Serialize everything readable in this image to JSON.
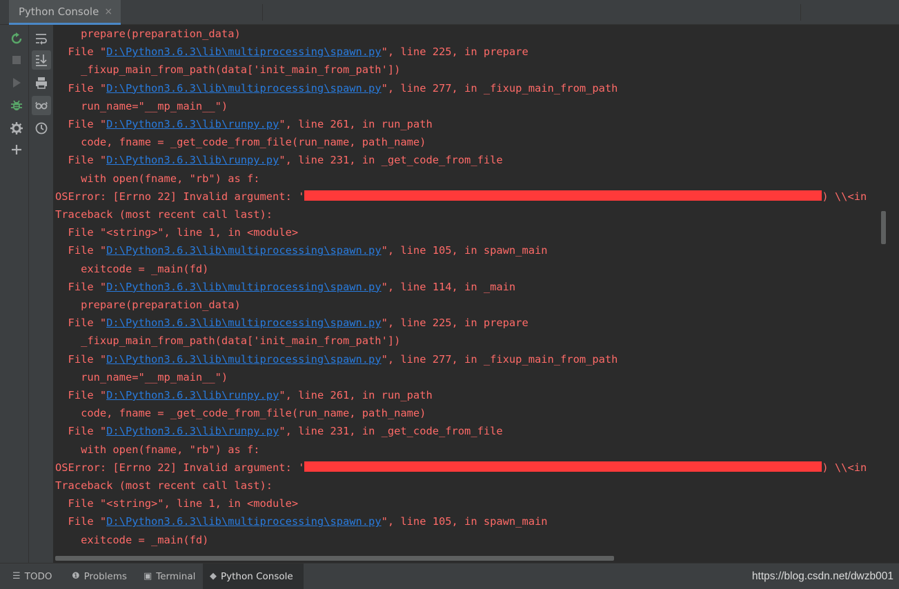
{
  "window": {
    "tab_title": "Python Console",
    "tab_close": "×"
  },
  "toolbar_left": [
    "rerun-icon",
    "stop-icon",
    "run-icon",
    "debug-icon",
    "settings-icon",
    "add-icon"
  ],
  "toolbar_right": [
    "soft-wrap-icon",
    "scroll-to-end-icon",
    "print-icon",
    "show-variables-icon",
    "history-icon"
  ],
  "console": {
    "lines": [
      {
        "indent": "    ",
        "parts": [
          {
            "t": "prepare(preparation_data)"
          }
        ]
      },
      {
        "indent": "  ",
        "parts": [
          {
            "t": "File \""
          },
          {
            "t": "D:\\Python3.6.3\\lib\\multiprocessing\\spawn.py",
            "link": true
          },
          {
            "t": "\", line 225, in prepare"
          }
        ]
      },
      {
        "indent": "    ",
        "parts": [
          {
            "t": "_fixup_main_from_path(data['init_main_from_path'])"
          }
        ]
      },
      {
        "indent": "  ",
        "parts": [
          {
            "t": "File \""
          },
          {
            "t": "D:\\Python3.6.3\\lib\\multiprocessing\\spawn.py",
            "link": true
          },
          {
            "t": "\", line 277, in _fixup_main_from_path"
          }
        ]
      },
      {
        "indent": "    ",
        "parts": [
          {
            "t": "run_name=\"__mp_main__\")"
          }
        ]
      },
      {
        "indent": "  ",
        "parts": [
          {
            "t": "File \""
          },
          {
            "t": "D:\\Python3.6.3\\lib\\runpy.py",
            "link": true
          },
          {
            "t": "\", line 261, in run_path"
          }
        ]
      },
      {
        "indent": "    ",
        "parts": [
          {
            "t": "code, fname = _get_code_from_file(run_name, path_name)"
          }
        ]
      },
      {
        "indent": "  ",
        "parts": [
          {
            "t": "File \""
          },
          {
            "t": "D:\\Python3.6.3\\lib\\runpy.py",
            "link": true
          },
          {
            "t": "\", line 231, in _get_code_from_file"
          }
        ]
      },
      {
        "indent": "    ",
        "parts": [
          {
            "t": "with open(fname, \"rb\") as f:"
          }
        ]
      },
      {
        "indent": "",
        "parts": [
          {
            "t": "OSError: [Errno 22] Invalid argument: '"
          },
          {
            "redact": 75
          },
          {
            "t": ") \\\\<in"
          }
        ]
      },
      {
        "indent": "",
        "parts": [
          {
            "t": "Traceback (most recent call last):"
          }
        ]
      },
      {
        "indent": "  ",
        "parts": [
          {
            "t": "File \"<string>\", line 1, in <module>"
          }
        ]
      },
      {
        "indent": "  ",
        "parts": [
          {
            "t": "File \""
          },
          {
            "t": "D:\\Python3.6.3\\lib\\multiprocessing\\spawn.py",
            "link": true
          },
          {
            "t": "\", line 105, in spawn_main"
          }
        ]
      },
      {
        "indent": "    ",
        "parts": [
          {
            "t": "exitcode = _main(fd)"
          }
        ]
      },
      {
        "indent": "  ",
        "parts": [
          {
            "t": "File \""
          },
          {
            "t": "D:\\Python3.6.3\\lib\\multiprocessing\\spawn.py",
            "link": true
          },
          {
            "t": "\", line 114, in _main"
          }
        ]
      },
      {
        "indent": "    ",
        "parts": [
          {
            "t": "prepare(preparation_data)"
          }
        ]
      },
      {
        "indent": "  ",
        "parts": [
          {
            "t": "File \""
          },
          {
            "t": "D:\\Python3.6.3\\lib\\multiprocessing\\spawn.py",
            "link": true
          },
          {
            "t": "\", line 225, in prepare"
          }
        ]
      },
      {
        "indent": "    ",
        "parts": [
          {
            "t": "_fixup_main_from_path(data['init_main_from_path'])"
          }
        ]
      },
      {
        "indent": "  ",
        "parts": [
          {
            "t": "File \""
          },
          {
            "t": "D:\\Python3.6.3\\lib\\multiprocessing\\spawn.py",
            "link": true
          },
          {
            "t": "\", line 277, in _fixup_main_from_path"
          }
        ]
      },
      {
        "indent": "    ",
        "parts": [
          {
            "t": "run_name=\"__mp_main__\")"
          }
        ]
      },
      {
        "indent": "  ",
        "parts": [
          {
            "t": "File \""
          },
          {
            "t": "D:\\Python3.6.3\\lib\\runpy.py",
            "link": true
          },
          {
            "t": "\", line 261, in run_path"
          }
        ]
      },
      {
        "indent": "    ",
        "parts": [
          {
            "t": "code, fname = _get_code_from_file(run_name, path_name)"
          }
        ]
      },
      {
        "indent": "  ",
        "parts": [
          {
            "t": "File \""
          },
          {
            "t": "D:\\Python3.6.3\\lib\\runpy.py",
            "link": true
          },
          {
            "t": "\", line 231, in _get_code_from_file"
          }
        ]
      },
      {
        "indent": "    ",
        "parts": [
          {
            "t": "with open(fname, \"rb\") as f:"
          }
        ]
      },
      {
        "indent": "",
        "parts": [
          {
            "t": "OSError: [Errno 22] Invalid argument: '"
          },
          {
            "redact": 75
          },
          {
            "t": ") \\\\<in"
          }
        ]
      },
      {
        "indent": "",
        "parts": [
          {
            "t": "Traceback (most recent call last):"
          }
        ]
      },
      {
        "indent": "  ",
        "parts": [
          {
            "t": "File \"<string>\", line 1, in <module>"
          }
        ]
      },
      {
        "indent": "  ",
        "parts": [
          {
            "t": "File \""
          },
          {
            "t": "D:\\Python3.6.3\\lib\\multiprocessing\\spawn.py",
            "link": true
          },
          {
            "t": "\", line 105, in spawn_main"
          }
        ]
      },
      {
        "indent": "    ",
        "parts": [
          {
            "t": "exitcode = _main(fd)"
          }
        ]
      }
    ]
  },
  "bottom_tabs": [
    {
      "label": "TODO",
      "icon": "todo-icon",
      "active": false
    },
    {
      "label": "Problems",
      "icon": "problems-icon",
      "active": false
    },
    {
      "label": "Terminal",
      "icon": "terminal-icon",
      "active": false
    },
    {
      "label": "Python Console",
      "icon": "python-icon",
      "active": true
    }
  ],
  "watermark": "https://blog.csdn.net/dwzb001",
  "colors": {
    "error_text": "#ff6b68",
    "link": "#287bde",
    "redaction": "#ff3a3a",
    "background": "#2b2b2b"
  }
}
